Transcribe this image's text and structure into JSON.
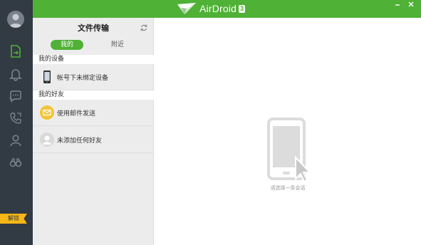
{
  "app": {
    "name": "AirDroid",
    "version": "3"
  },
  "nav": {
    "unlock_label": "解锁",
    "items": [
      {
        "icon": "file-transfer-icon",
        "active": true
      },
      {
        "icon": "bell-icon"
      },
      {
        "icon": "chat-icon"
      },
      {
        "icon": "phone-call-icon"
      },
      {
        "icon": "contact-icon"
      },
      {
        "icon": "binoculars-icon"
      }
    ]
  },
  "panel": {
    "title": "文件传输",
    "tabs": [
      {
        "label": "我的",
        "selected": true
      },
      {
        "label": "附近",
        "selected": false
      }
    ],
    "devices_section": "我的设备",
    "device_row": "帐号下未绑定设备",
    "friends_section": "我的好友",
    "friend_rows": [
      "使用邮件发送",
      "未添加任何好友"
    ]
  },
  "content": {
    "hint": "请选择一条会话"
  },
  "colors": {
    "accent": "#4fb135",
    "nav_bg": "#323a44",
    "badge": "#f6b717",
    "mail_icon": "#f3c43a"
  }
}
